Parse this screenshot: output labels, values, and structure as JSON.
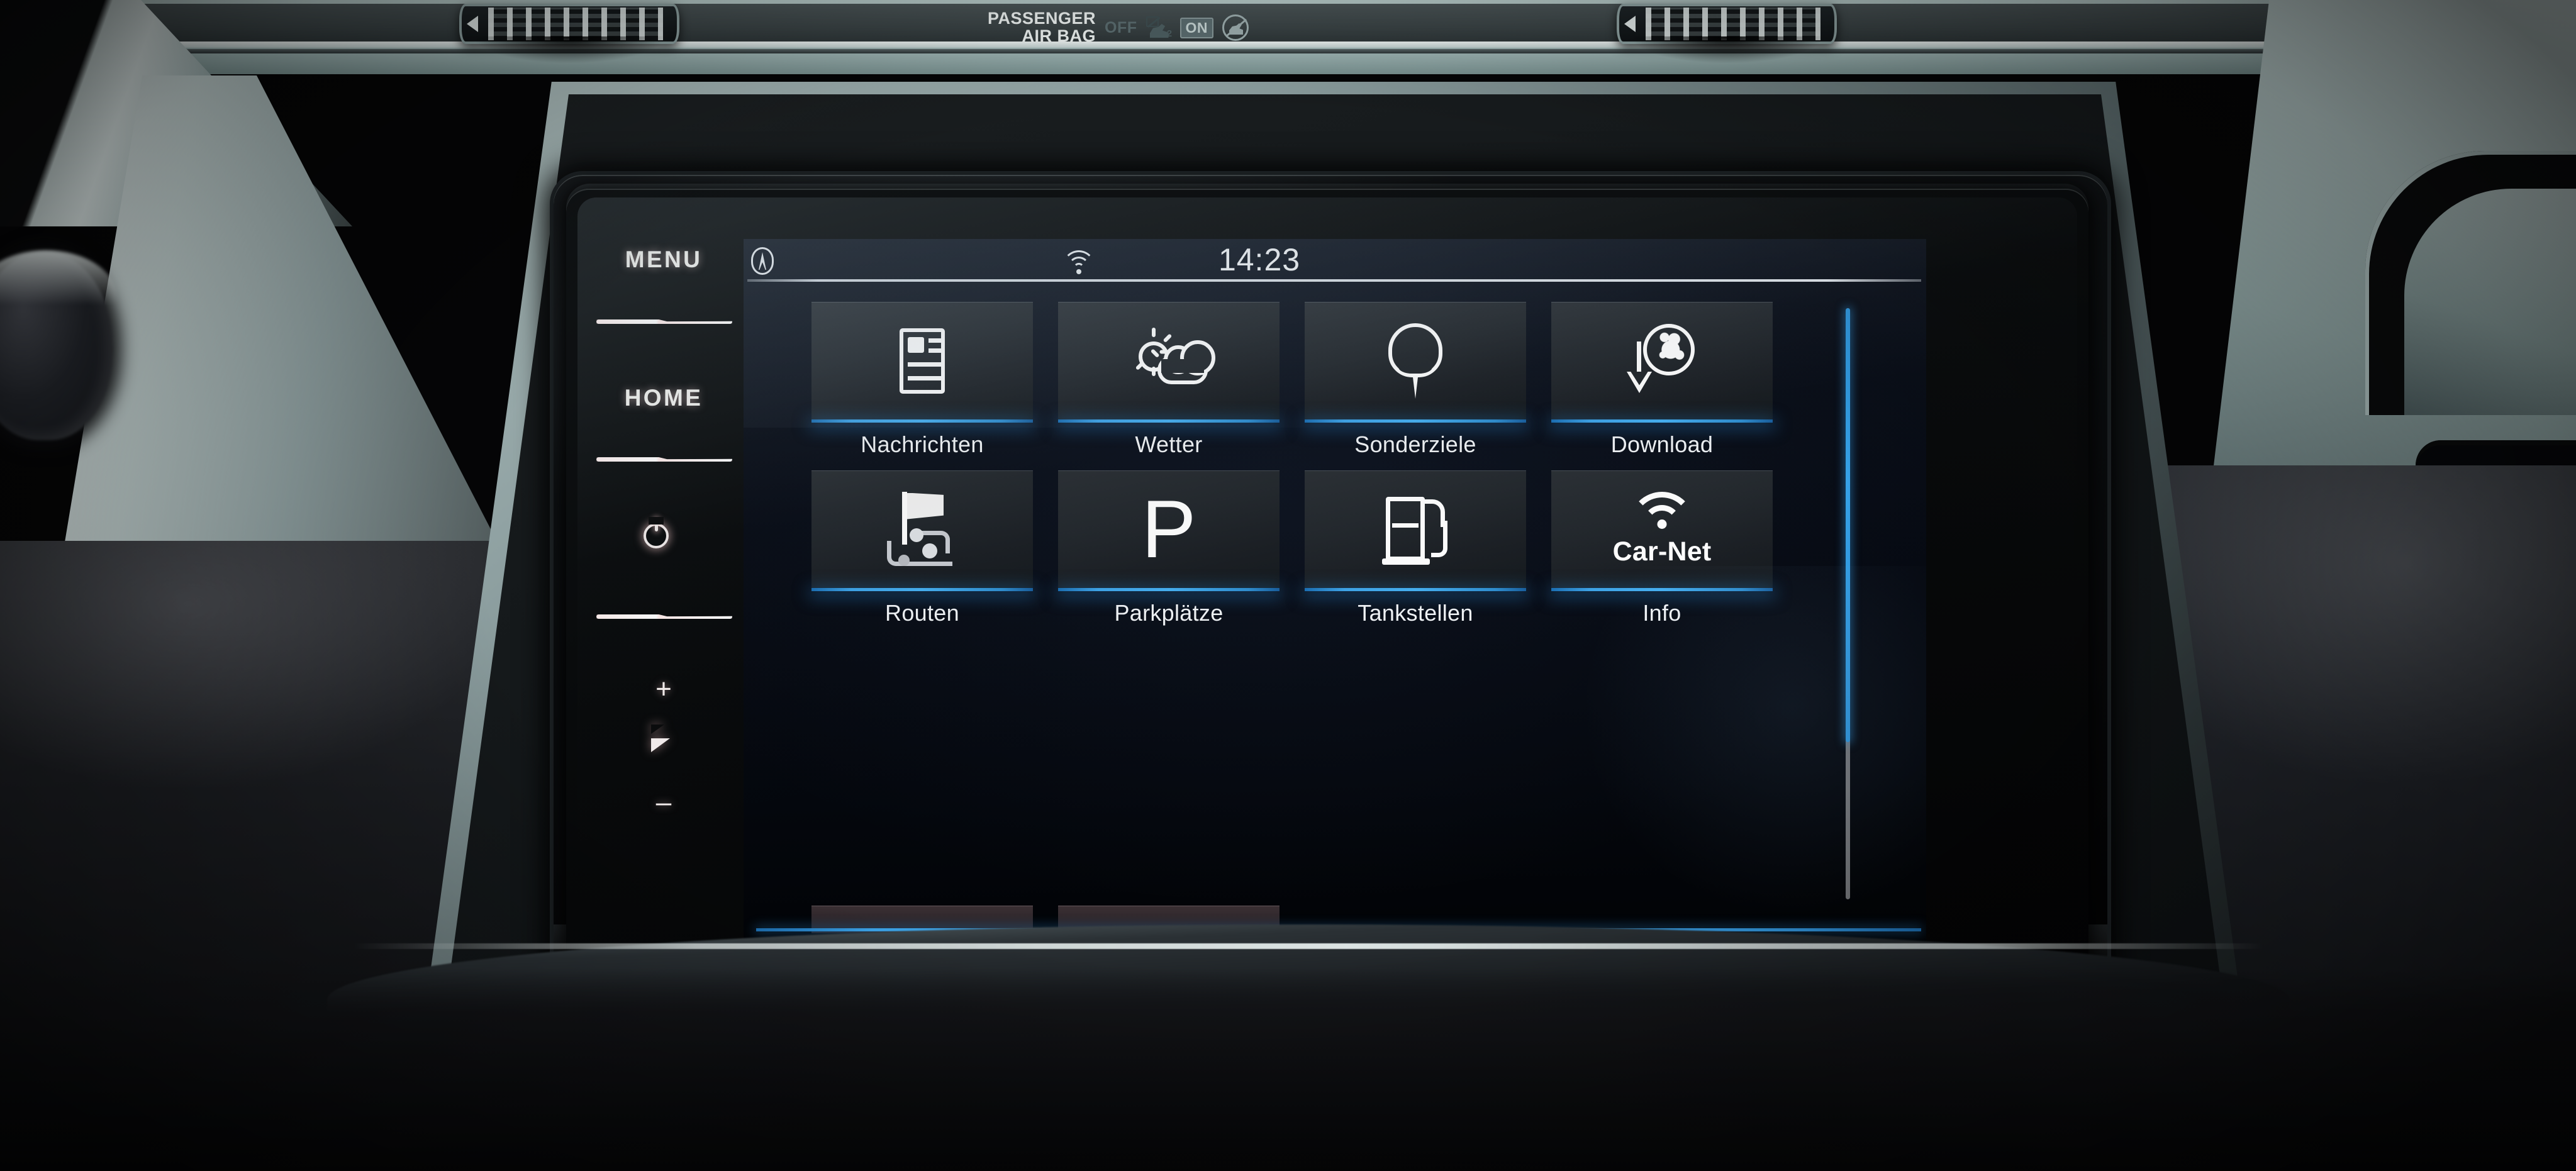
{
  "vehicle": {
    "airbag_indicator": {
      "label_line1": "PASSENGER",
      "label_line2": "AIR BAG",
      "off_label": "OFF",
      "on_label": "ON",
      "off_icon": "airbag-off-icon",
      "on_icon": "no-child-seat-icon"
    },
    "vent_left_icon": "air-vent-icon",
    "vent_right_icon": "air-vent-icon",
    "shift_knob_icon": "gear-shift-knob-icon"
  },
  "hardware_buttons": {
    "menu_label": "MENU",
    "home_label": "HOME",
    "power_icon": "power-icon",
    "volume_up_label": "+",
    "volume_icon": "volume-icon",
    "volume_down_label": "–"
  },
  "screen": {
    "status_bar": {
      "compass_icon": "compass-icon",
      "wifi_icon": "wifi-icon",
      "clock": "14:23"
    },
    "accent_color": "#3ba2e6",
    "tile_bg_color": "#262b30",
    "scrollbar": {
      "thumb_color": "#36a3ea",
      "track_color": "#6d6f72",
      "thumb_position_percent": 0,
      "thumb_size_percent": 73
    },
    "tiles": [
      {
        "label": "Nachrichten",
        "icon": "newspaper-icon"
      },
      {
        "label": "Wetter",
        "icon": "sun-cloud-icon"
      },
      {
        "label": "Sonderziele",
        "icon": "map-pin-icon"
      },
      {
        "label": "Download",
        "icon": "globe-download-icon"
      },
      {
        "label": "Routen",
        "icon": "route-flag-icon"
      },
      {
        "label": "Parkplätze",
        "icon": "parking-p-icon"
      },
      {
        "label": "Tankstellen",
        "icon": "fuel-pump-icon"
      },
      {
        "label": "Info",
        "icon": "car-net-wifi-icon"
      }
    ],
    "tile_glyph_text": {
      "parking": "P",
      "car_net": "Car-Net"
    },
    "bottom_bar": {
      "settings_icon": "settings-gears-icon"
    }
  }
}
